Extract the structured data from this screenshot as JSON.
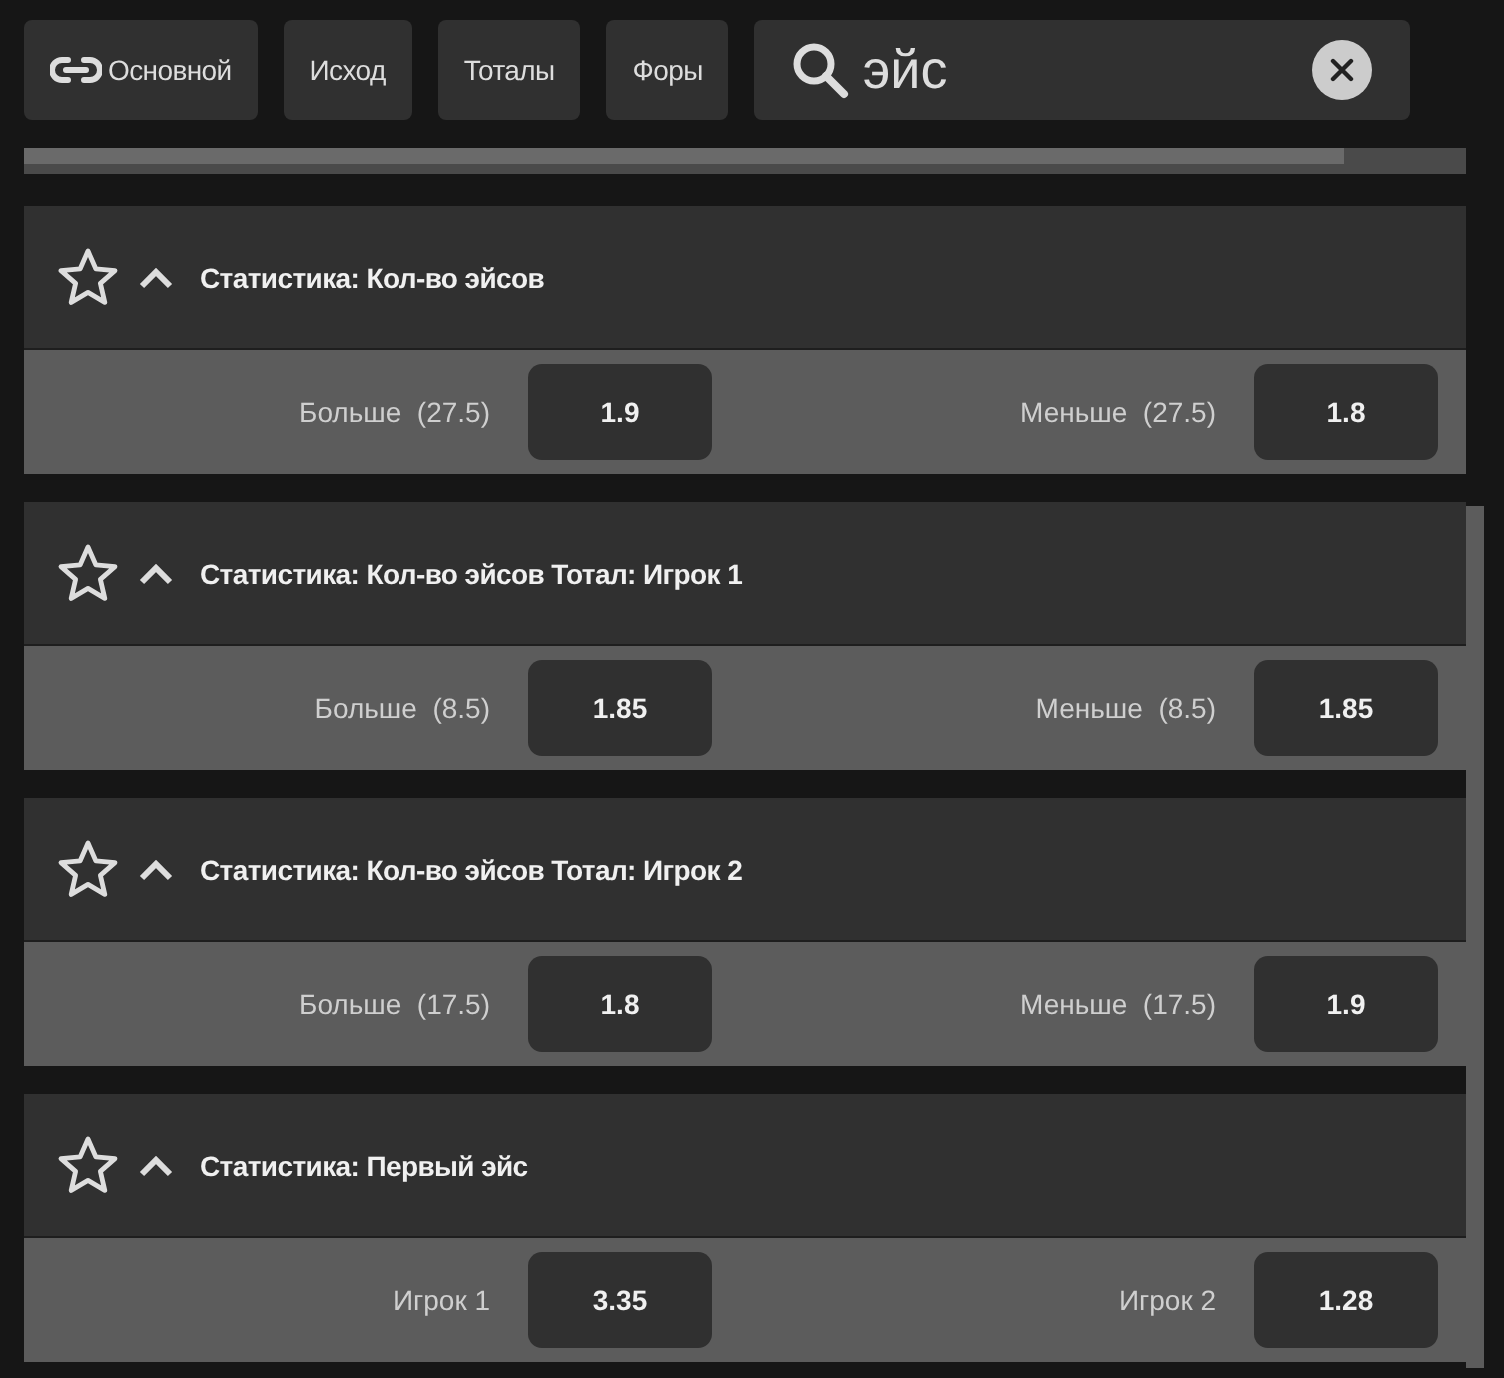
{
  "filters": [
    {
      "label": "Основной",
      "kind": "linked",
      "selected": false
    },
    {
      "label": "Исход",
      "selected": false
    },
    {
      "label": "Тоталы",
      "selected": false
    },
    {
      "label": "Форы",
      "selected": false
    }
  ],
  "search": {
    "value": "эйс"
  },
  "markets": [
    {
      "title": "Статистика: Кол-во эйсов",
      "favorite": false,
      "expanded": true,
      "outcomes": [
        {
          "label": "Больше  (27.5)",
          "odds": "1.9"
        },
        {
          "label": "Меньше  (27.5)",
          "odds": "1.8"
        }
      ]
    },
    {
      "title": "Статистика: Кол-во эйсов Тотал: Игрок 1",
      "favorite": false,
      "expanded": true,
      "outcomes": [
        {
          "label": "Больше  (8.5)",
          "odds": "1.85"
        },
        {
          "label": "Меньше  (8.5)",
          "odds": "1.85"
        }
      ]
    },
    {
      "title": "Статистика: Кол-во эйсов Тотал: Игрок 2",
      "favorite": false,
      "expanded": true,
      "outcomes": [
        {
          "label": "Больше  (17.5)",
          "odds": "1.8"
        },
        {
          "label": "Меньше  (17.5)",
          "odds": "1.9"
        }
      ]
    },
    {
      "title": "Статистика: Первый эйс",
      "favorite": false,
      "expanded": true,
      "outcomes": [
        {
          "label": "Игрок 1",
          "odds": "3.35"
        },
        {
          "label": "Игрок 2",
          "odds": "1.28"
        }
      ]
    }
  ]
}
